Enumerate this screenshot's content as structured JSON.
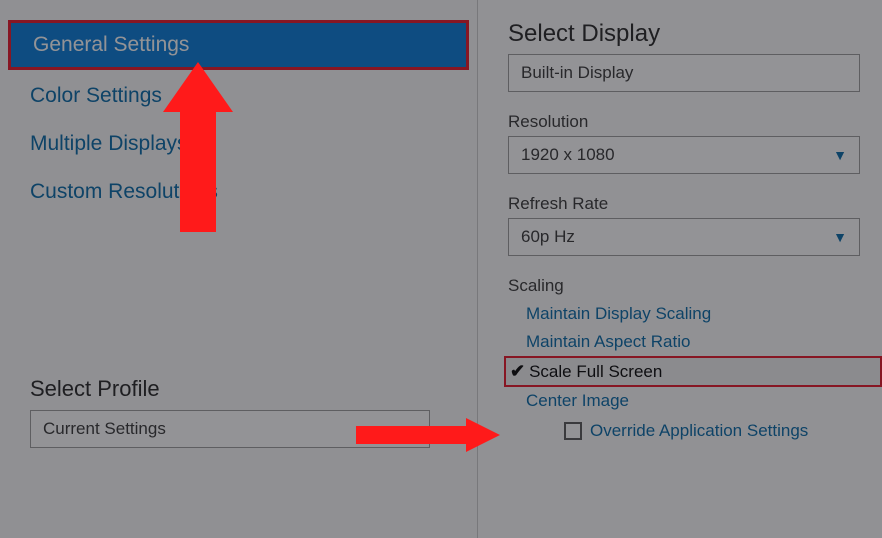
{
  "sidebar": {
    "items": [
      {
        "label": "General Settings",
        "selected": true
      },
      {
        "label": "Color Settings",
        "selected": false
      },
      {
        "label": "Multiple Displays",
        "selected": false
      },
      {
        "label": "Custom Resolutions",
        "selected": false
      }
    ],
    "profile": {
      "heading": "Select Profile",
      "value": "Current Settings"
    }
  },
  "main": {
    "display": {
      "heading": "Select Display",
      "value": "Built-in Display"
    },
    "resolution": {
      "label": "Resolution",
      "value": "1920 x 1080"
    },
    "refresh": {
      "label": "Refresh Rate",
      "value": "60p Hz"
    },
    "scaling": {
      "label": "Scaling",
      "options": [
        {
          "label": "Maintain Display Scaling",
          "selected": false
        },
        {
          "label": "Maintain Aspect Ratio",
          "selected": false
        },
        {
          "label": "Scale Full Screen",
          "selected": true
        },
        {
          "label": "Center Image",
          "selected": false
        }
      ],
      "override": "Override Application Settings"
    }
  }
}
